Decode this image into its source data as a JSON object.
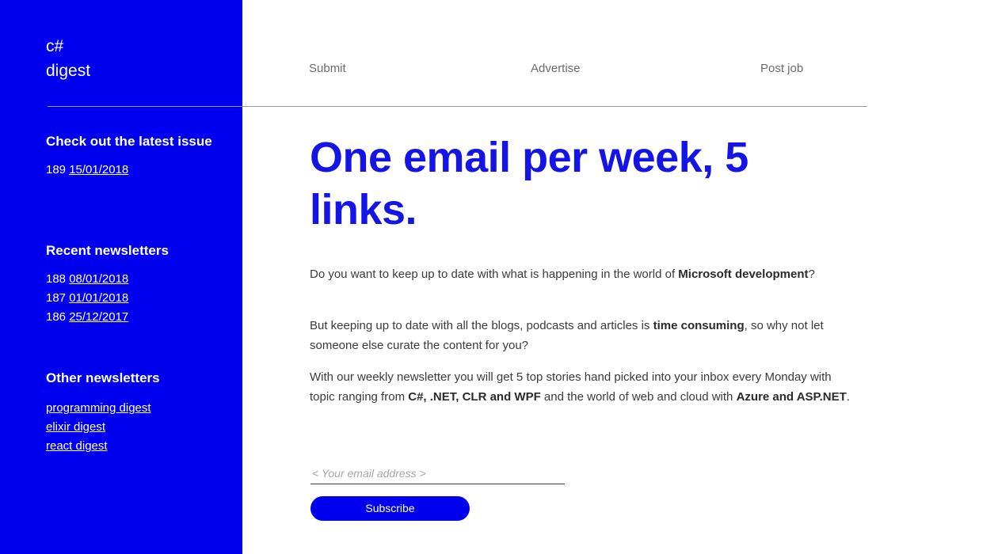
{
  "brand": {
    "line1": "c#",
    "line2": "digest"
  },
  "nav": {
    "submit": "Submit",
    "advertise": "Advertise",
    "post_job": "Post job"
  },
  "sidebar": {
    "latest": {
      "heading": "Check out the latest issue",
      "issue_number": "189",
      "issue_date": "15/01/2018"
    },
    "recent": {
      "heading": "Recent newsletters",
      "items": [
        {
          "number": "188",
          "date": "08/01/2018"
        },
        {
          "number": "187",
          "date": "01/01/2018"
        },
        {
          "number": "186",
          "date": "25/12/2017"
        }
      ]
    },
    "other": {
      "heading": "Other newsletters",
      "links": [
        "programming digest",
        "elixir digest",
        "react digest"
      ]
    }
  },
  "main": {
    "hero_title": "One email per week, 5 links.",
    "paragraph_1": {
      "part_1": "Do you want to keep up to date with what is happening in the world of ",
      "bold_1": "Microsoft development",
      "part_2": "?"
    },
    "paragraph_2": {
      "part_1": "But keeping up to date with all the blogs, podcasts and articles is ",
      "bold_1": "time consuming",
      "part_2": ", so why not let someone else curate the content for you?"
    },
    "paragraph_3": {
      "part_1": "With our weekly newsletter you will get 5 top stories hand picked into your inbox every Monday with topic ranging from ",
      "bold_1": "C#, .NET, CLR and WPF",
      "part_2": " and the world of web and cloud with ",
      "bold_2": "Azure and ASP.NET",
      "part_3": "."
    },
    "email_placeholder": "< Your email address >",
    "email_value": "",
    "subscribe_label": "Subscribe"
  },
  "colors": {
    "brand_blue": "#0000ee",
    "heading_blue": "#1414e6",
    "nav_gray": "#6b6b6b",
    "body_gray": "#3a3a3a",
    "divider_gray": "#9a9a9a"
  }
}
